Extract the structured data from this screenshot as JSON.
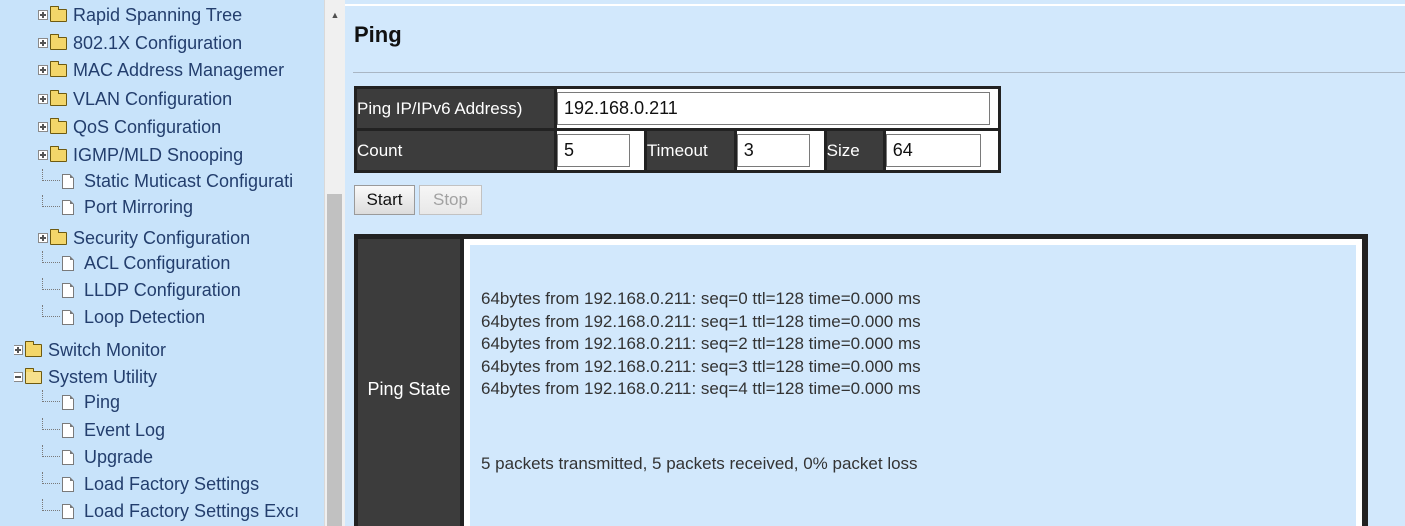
{
  "sidebar": {
    "items": [
      {
        "label": "Rapid Spanning Tree",
        "kind": "folder",
        "expanded": false,
        "indent": 1
      },
      {
        "label": "802.1X Configuration",
        "kind": "folder",
        "expanded": false,
        "indent": 1
      },
      {
        "label": "MAC Address Managemer",
        "kind": "folder",
        "expanded": false,
        "indent": 1
      },
      {
        "label": "VLAN Configuration",
        "kind": "folder",
        "expanded": false,
        "indent": 1
      },
      {
        "label": "QoS Configuration",
        "kind": "folder",
        "expanded": false,
        "indent": 1
      },
      {
        "label": "IGMP/MLD Snooping",
        "kind": "folder",
        "expanded": false,
        "indent": 1
      },
      {
        "label": "Static Muticast Configurati",
        "kind": "page",
        "indent": 1
      },
      {
        "label": "Port Mirroring",
        "kind": "page",
        "indent": 1
      },
      {
        "label": "Security Configuration",
        "kind": "folder",
        "expanded": false,
        "indent": 1
      },
      {
        "label": "ACL Configuration",
        "kind": "page",
        "indent": 1
      },
      {
        "label": "LLDP Configuration",
        "kind": "page",
        "indent": 1
      },
      {
        "label": "Loop Detection",
        "kind": "page",
        "indent": 1
      },
      {
        "label": "Switch Monitor",
        "kind": "folder",
        "expanded": false,
        "indent": 0
      },
      {
        "label": "System Utility",
        "kind": "folder",
        "expanded": true,
        "indent": 0
      },
      {
        "label": "Ping",
        "kind": "page",
        "indent": 1
      },
      {
        "label": "Event Log",
        "kind": "page",
        "indent": 1
      },
      {
        "label": "Upgrade",
        "kind": "page",
        "indent": 1
      },
      {
        "label": "Load Factory Settings",
        "kind": "page",
        "indent": 1
      },
      {
        "label": "Load Factory Settings Excı",
        "kind": "page",
        "indent": 1
      }
    ]
  },
  "page": {
    "title": "Ping",
    "ping_address_label": "Ping IP/IPv6 Address)",
    "ping_address_value": "192.168.0.211",
    "count_label": "Count",
    "count_value": "5",
    "timeout_label": "Timeout",
    "timeout_value": "3",
    "size_label": "Size",
    "size_value": "64",
    "start_label": "Start",
    "stop_label": "Stop",
    "stop_enabled": false,
    "ping_state_label": "Ping State",
    "ping_lines": [
      "64bytes from 192.168.0.211: seq=0 ttl=128 time=0.000 ms",
      "64bytes from 192.168.0.211: seq=1 ttl=128 time=0.000 ms",
      "64bytes from 192.168.0.211: seq=2 ttl=128 time=0.000 ms",
      "64bytes from 192.168.0.211: seq=3 ttl=128 time=0.000 ms",
      "64bytes from 192.168.0.211: seq=4 ttl=128 time=0.000 ms"
    ],
    "summary": "5 packets transmitted, 5 packets received, 0% packet loss"
  }
}
